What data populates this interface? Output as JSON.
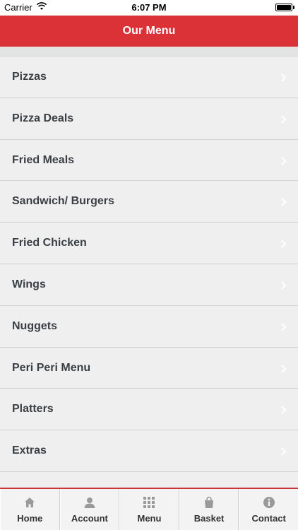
{
  "status_bar": {
    "carrier": "Carrier",
    "time": "6:07 PM"
  },
  "nav": {
    "title": "Our Menu"
  },
  "menu": {
    "items": [
      {
        "label": "Pizzas"
      },
      {
        "label": "Pizza Deals"
      },
      {
        "label": "Fried Meals"
      },
      {
        "label": "Sandwich/ Burgers"
      },
      {
        "label": "Fried Chicken"
      },
      {
        "label": "Wings"
      },
      {
        "label": "Nuggets"
      },
      {
        "label": "Peri Peri Menu"
      },
      {
        "label": "Platters"
      },
      {
        "label": "Extras"
      }
    ]
  },
  "tab_bar": {
    "tabs": [
      {
        "label": "Home",
        "icon": "home-icon"
      },
      {
        "label": "Account",
        "icon": "user-icon"
      },
      {
        "label": "Menu",
        "icon": "grid-icon"
      },
      {
        "label": "Basket",
        "icon": "basket-icon"
      },
      {
        "label": "Contact",
        "icon": "info-icon"
      }
    ]
  },
  "colors": {
    "brand_red": "#db3238",
    "background": "#efefef",
    "icon_gray": "#9a9a9a"
  }
}
